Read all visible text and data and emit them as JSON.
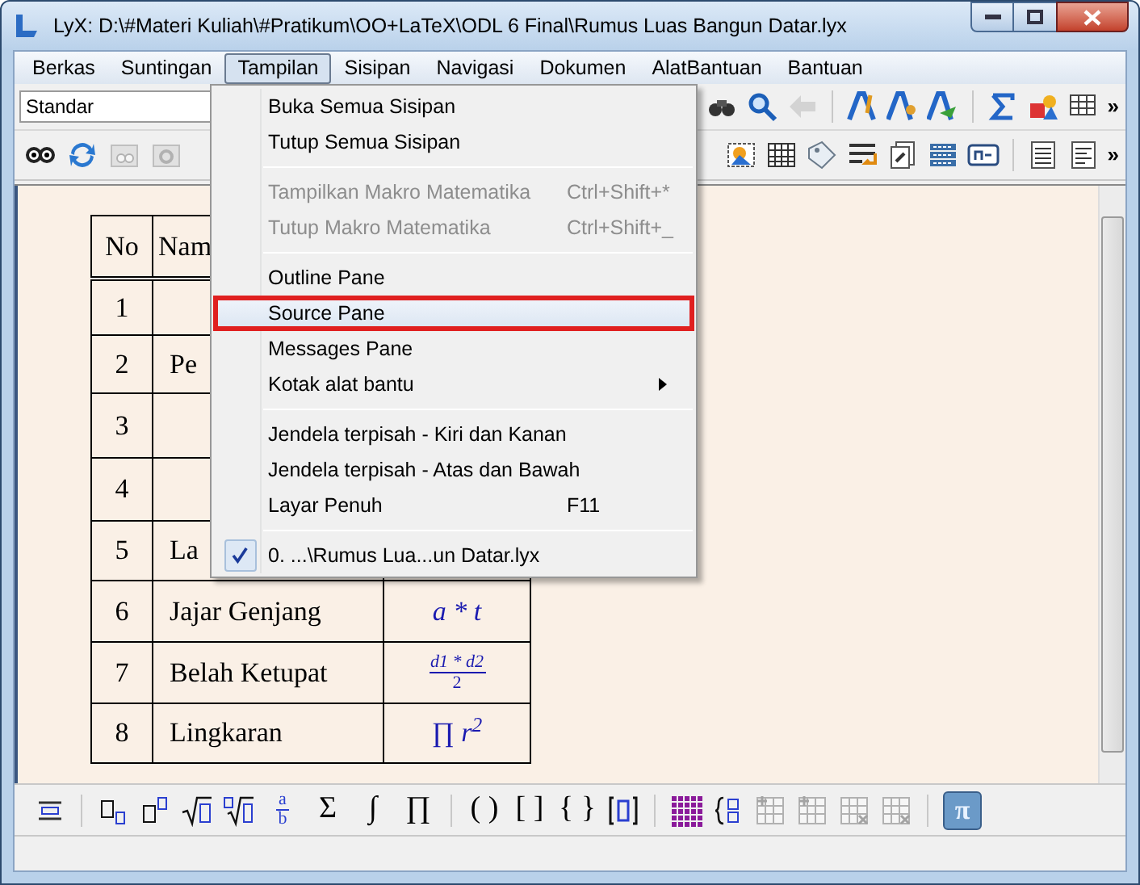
{
  "window": {
    "title": "LyX: D:\\#Materi Kuliah\\#Pratikum\\OO+LaTeX\\ODL 6 Final\\Rumus Luas Bangun Datar.lyx"
  },
  "menubar": [
    {
      "label": "Berkas",
      "selected": false
    },
    {
      "label": "Suntingan",
      "selected": false
    },
    {
      "label": "Tampilan",
      "selected": true
    },
    {
      "label": "Sisipan",
      "selected": false
    },
    {
      "label": "Navigasi",
      "selected": false
    },
    {
      "label": "Dokumen",
      "selected": false
    },
    {
      "label": "AlatBantuan",
      "selected": false
    },
    {
      "label": "Bantuan",
      "selected": false
    }
  ],
  "toolbar": {
    "style_combo": "Standar",
    "overflow": "»",
    "overflow_2": "»"
  },
  "menu": [
    {
      "kind": "item",
      "label": "Buka Semua Sisipan",
      "disabled": false,
      "selected": false
    },
    {
      "kind": "item",
      "label": "Tutup Semua Sisipan",
      "disabled": false,
      "selected": false
    },
    {
      "kind": "separator"
    },
    {
      "kind": "item",
      "label": "Tampilkan Makro Matematika",
      "shortcut": "Ctrl+Shift+*",
      "disabled": true,
      "selected": false
    },
    {
      "kind": "item",
      "label": "Tutup Makro Matematika",
      "shortcut": "Ctrl+Shift+_",
      "disabled": true,
      "selected": false
    },
    {
      "kind": "separator"
    },
    {
      "kind": "item",
      "label": "Outline Pane",
      "disabled": false,
      "selected": false
    },
    {
      "kind": "item",
      "label": "Source Pane",
      "disabled": false,
      "selected": true
    },
    {
      "kind": "item",
      "label": "Messages Pane",
      "disabled": false,
      "selected": false
    },
    {
      "kind": "item",
      "label": "Kotak alat bantu",
      "disabled": false,
      "selected": false,
      "submenu": true
    },
    {
      "kind": "separator"
    },
    {
      "kind": "item",
      "label": "Jendela terpisah - Kiri dan Kanan",
      "disabled": false,
      "selected": false
    },
    {
      "kind": "item",
      "label": "Jendela terpisah - Atas dan Bawah",
      "disabled": false,
      "selected": false
    },
    {
      "kind": "item",
      "label": "Layar Penuh",
      "shortcut": "F11",
      "disabled": false,
      "selected": false
    },
    {
      "kind": "separator"
    },
    {
      "kind": "item",
      "label": "0. ...\\Rumus Lua...un Datar.lyx",
      "disabled": false,
      "selected": false,
      "checked": true
    }
  ],
  "table": {
    "columns": [
      "No",
      "Nam"
    ],
    "rows": [
      {
        "no": "1"
      },
      {
        "no": "2",
        "name": "Pe"
      },
      {
        "no": "3"
      },
      {
        "no": "4"
      },
      {
        "no": "5",
        "name": "La"
      },
      {
        "no": "6",
        "name": "Jajar Genjang",
        "formula": {
          "kind": "text",
          "text": "a * t"
        }
      },
      {
        "no": "7",
        "name": "Belah Ketupat",
        "formula": {
          "kind": "fraction",
          "numerator": "d1 * d2",
          "denominator": "2"
        }
      },
      {
        "no": "8",
        "name": "Lingkaran",
        "formula": {
          "kind": "text",
          "text": "∏ r$^{2}$"
        }
      }
    ]
  },
  "math_toolbar": {
    "fraction": {
      "numerator": "a",
      "denominator": "b"
    },
    "symbols": [
      "Σ",
      "∫",
      "∏",
      "( )",
      "[ ]",
      "{ }"
    ],
    "pi": {
      "label": "π",
      "selected": true
    }
  }
}
